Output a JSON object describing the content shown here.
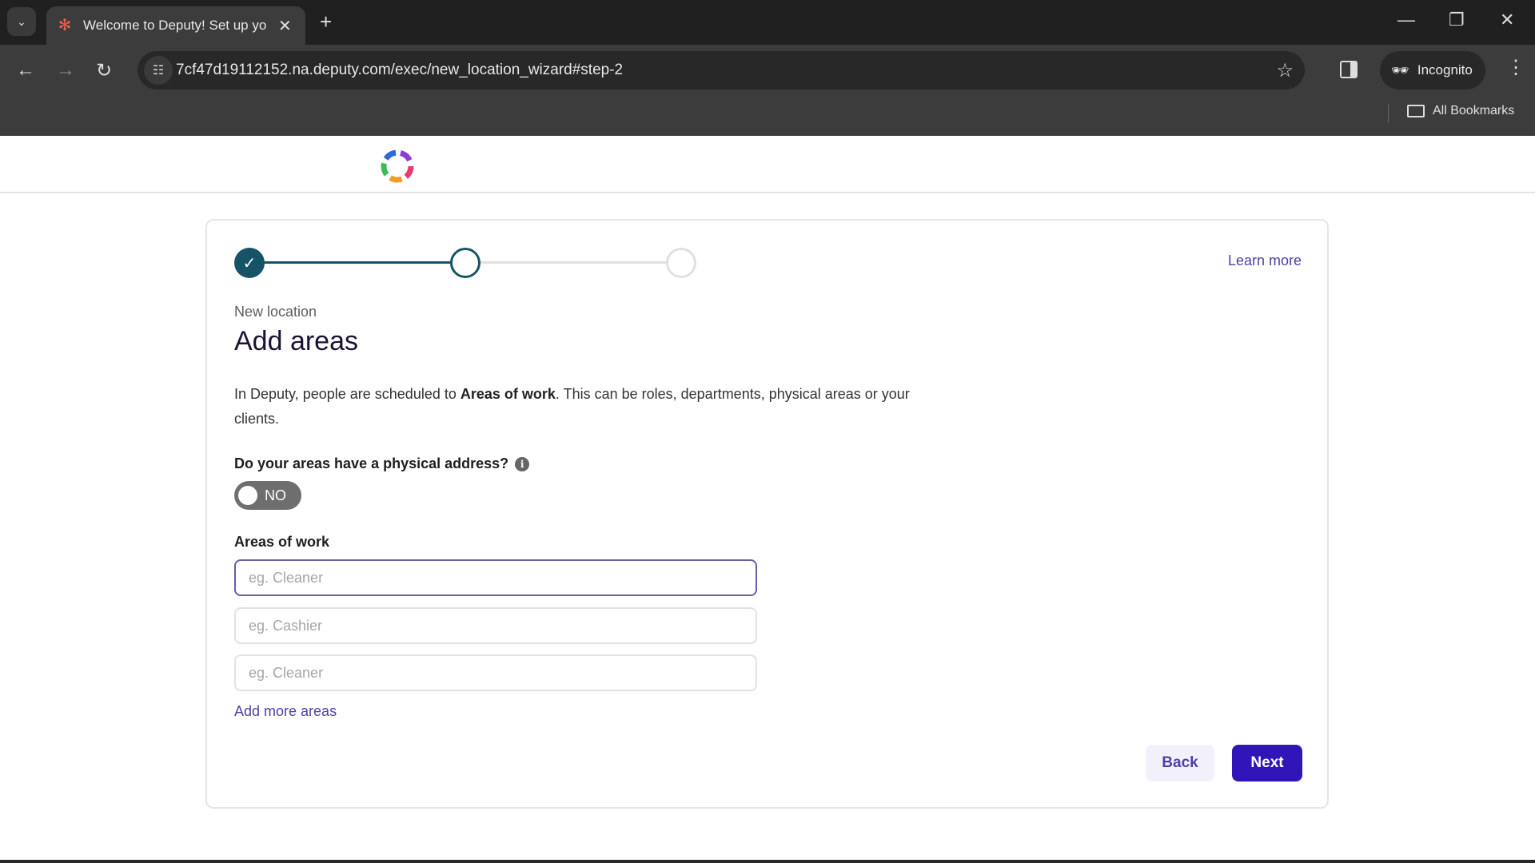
{
  "browser": {
    "tab_title": "Welcome to Deputy! Set up you",
    "url": "7cf47d19112152.na.deputy.com/exec/new_location_wizard#step-2",
    "incognito_label": "Incognito",
    "all_bookmarks_label": "All Bookmarks",
    "icons": {
      "tab_list": "chevron-down-icon",
      "favicon": "deputy-favicon",
      "close": "close-icon",
      "new_tab": "plus-icon",
      "back": "arrow-left-icon",
      "forward": "arrow-right-icon",
      "reload": "reload-icon",
      "site_info": "tune-icon",
      "bookmark": "star-icon",
      "side_panel": "side-panel-icon",
      "incognito": "incognito-icon",
      "menu": "more-vertical-icon",
      "folder": "folder-icon"
    },
    "glyphs": {
      "tab_list": "⌄",
      "favicon": "✻",
      "close": "✕",
      "new_tab": "+",
      "back": "←",
      "forward": "→",
      "reload": "↻",
      "site_info": "☷",
      "star": "☆",
      "incognito": "🕶",
      "menu": "⋮",
      "minimize": "—",
      "restore": "❐",
      "window_close": "✕"
    }
  },
  "wizard": {
    "steps": [
      {
        "status": "completed"
      },
      {
        "status": "current"
      },
      {
        "status": "upcoming"
      }
    ],
    "current_step": 2,
    "total_steps": 3,
    "check_glyph": "✓",
    "learn_more": "Learn more",
    "eyebrow": "New location",
    "title": "Add areas",
    "description_prefix": "In Deputy, people are scheduled to ",
    "description_bold": "Areas of work",
    "description_suffix": ". This can be roles, departments, physical areas or your clients.",
    "physical_address_question": "Do your areas have a physical address?",
    "info_glyph": "i",
    "physical_address_toggle": {
      "state": "off",
      "label": "NO"
    },
    "areas_label": "Areas of work",
    "areas": [
      {
        "value": "",
        "placeholder": "eg. Cleaner",
        "focused": true
      },
      {
        "value": "",
        "placeholder": "eg. Cashier",
        "focused": false
      },
      {
        "value": "",
        "placeholder": "eg. Cleaner",
        "focused": false
      }
    ],
    "add_more": "Add more areas",
    "back_label": "Back",
    "next_label": "Next"
  },
  "colors": {
    "primary": "#3215b8",
    "step_accent": "#155466",
    "link": "#4f3fa6"
  }
}
